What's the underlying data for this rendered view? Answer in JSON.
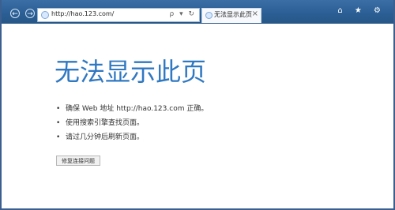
{
  "browser": {
    "address": "http://hao.123.com/",
    "address_icons": "ρ ▾ ↻",
    "tab_label": "无法显示此页",
    "tab_close": "×",
    "window_controls": "⌂ ★ ⚙",
    "back_icon": "left-arrow-icon",
    "forward_icon": "right-arrow-icon"
  },
  "page": {
    "title": "无法显示此页",
    "items": [
      "确保 Web 地址 http://hao.123.com 正确。",
      "使用搜索引擎查找页面。",
      "请过几分钟后刷新页面。"
    ],
    "button": "修复连接问题"
  }
}
